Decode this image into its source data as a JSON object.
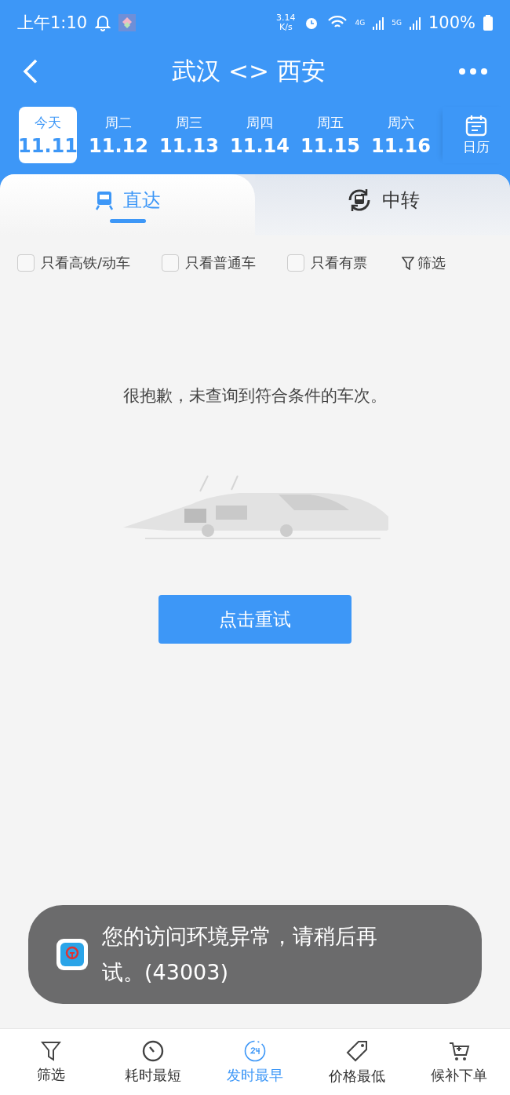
{
  "status_bar": {
    "time": "上午1:10",
    "speed": "3.14",
    "speed_unit": "K/s",
    "network_1": "4G",
    "network_2": "5G",
    "battery": "100%"
  },
  "header": {
    "title": "武汉 <> 西安"
  },
  "dates": [
    {
      "weekday": "今天",
      "date": "11.11",
      "selected": true
    },
    {
      "weekday": "周二",
      "date": "11.12",
      "selected": false
    },
    {
      "weekday": "周三",
      "date": "11.13",
      "selected": false
    },
    {
      "weekday": "周四",
      "date": "11.14",
      "selected": false
    },
    {
      "weekday": "周五",
      "date": "11.15",
      "selected": false
    },
    {
      "weekday": "周六",
      "date": "11.16",
      "selected": false
    }
  ],
  "calendar_label": "日历",
  "tabs": [
    {
      "label": "直达",
      "kind": "direct",
      "selected": true
    },
    {
      "label": "中转",
      "kind": "transfer",
      "selected": false
    }
  ],
  "filters": [
    {
      "label": "只看高铁/动车",
      "checked": false
    },
    {
      "label": "只看普通车",
      "checked": false
    },
    {
      "label": "只看有票",
      "checked": false
    }
  ],
  "filter_button": "筛选",
  "empty_message": "很抱歉，未查询到符合条件的车次。",
  "retry_button": "点击重试",
  "toast": {
    "message": "您的访问环境异常，请稍后再试。(43003)"
  },
  "bottom_tabs": [
    {
      "label": "筛选",
      "kind": "filter",
      "selected": false
    },
    {
      "label": "耗时最短",
      "kind": "duration",
      "selected": false
    },
    {
      "label": "发时最早",
      "kind": "earliest",
      "selected": true
    },
    {
      "label": "价格最低",
      "kind": "price",
      "selected": false
    },
    {
      "label": "候补下单",
      "kind": "waitlist",
      "selected": false
    }
  ]
}
